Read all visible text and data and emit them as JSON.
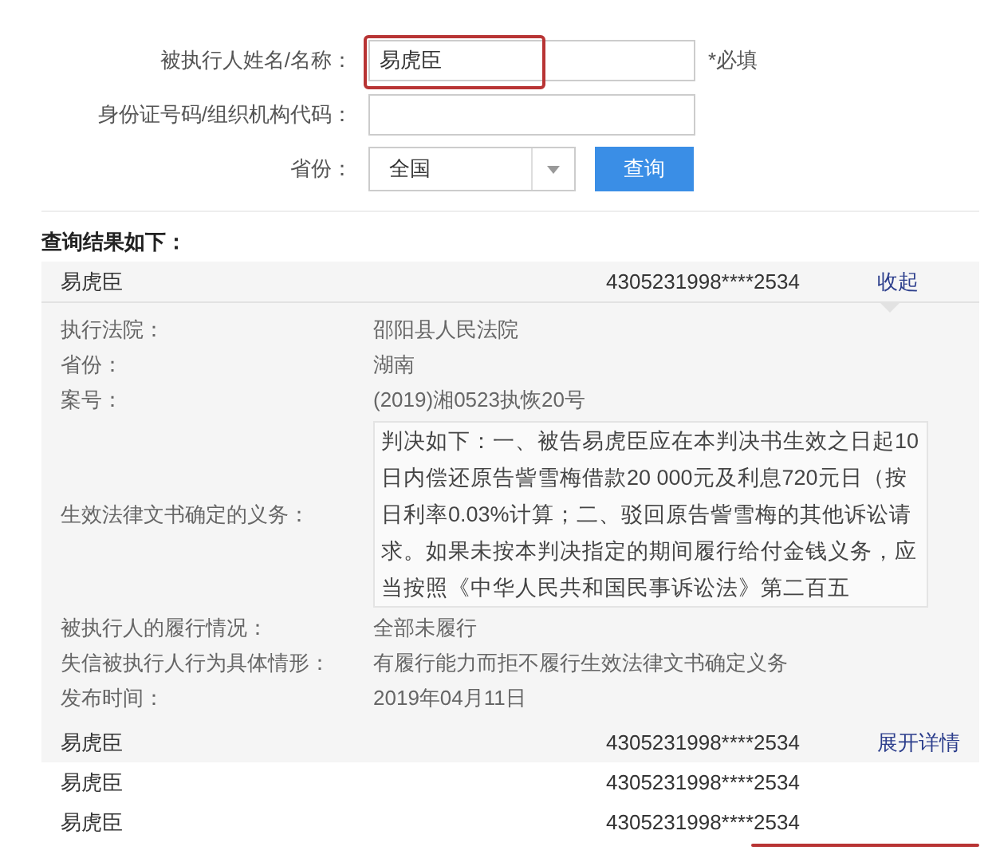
{
  "search_form": {
    "fields": [
      {
        "kind": "text",
        "label": "被执行人姓名/名称：",
        "value": "易虎臣",
        "note": "*必填",
        "highlighted": true
      },
      {
        "kind": "text",
        "label": "身份证号码/组织机构代码："
      },
      {
        "kind": "select",
        "label": "省份：",
        "value": "全国"
      }
    ],
    "button": "查询"
  },
  "results": {
    "heading": "查询结果如下：",
    "records": [
      {
        "name": "易虎臣",
        "id_number": "4305231998****2534",
        "toggle": "收起",
        "details": [
          {
            "kind": "line",
            "label": "执行法院：",
            "value": "邵阳县人民法院"
          },
          {
            "kind": "line",
            "label": "省份：",
            "value": "湖南"
          },
          {
            "kind": "line",
            "label": "案号：",
            "value": "(2019)湘0523执恢20号"
          },
          {
            "kind": "scroll_text",
            "label": "生效法律文书确定的义务：",
            "value": "判决如下：一、被告易虎臣应在本判决书生效之日起10日内偿还原告訾雪梅借款20 000元及利息720元日（按日利率0.03%计算；二、驳回原告訾雪梅的其他诉讼请求。如果未按本判决指定的期间履行给付金钱义务，应当按照《中华人民共和国民事诉讼法》第二百五"
          },
          {
            "kind": "line",
            "label": "被执行人的履行情况：",
            "value": "全部未履行"
          },
          {
            "kind": "line",
            "label": "失信被执行人行为具体情形：",
            "value": "有履行能力而拒不履行生效法律文书确定义务"
          },
          {
            "kind": "line",
            "label": "发布时间：",
            "value": "2019年04月11日"
          }
        ]
      },
      {
        "name": "易虎臣",
        "id_number": "4305231998****2534",
        "toggle": "展开详情"
      },
      {
        "name": "易虎臣",
        "id_number": "4305231998****2534"
      },
      {
        "name": "易虎臣",
        "id_number": "4305231998****2534",
        "underlined": true
      }
    ]
  }
}
